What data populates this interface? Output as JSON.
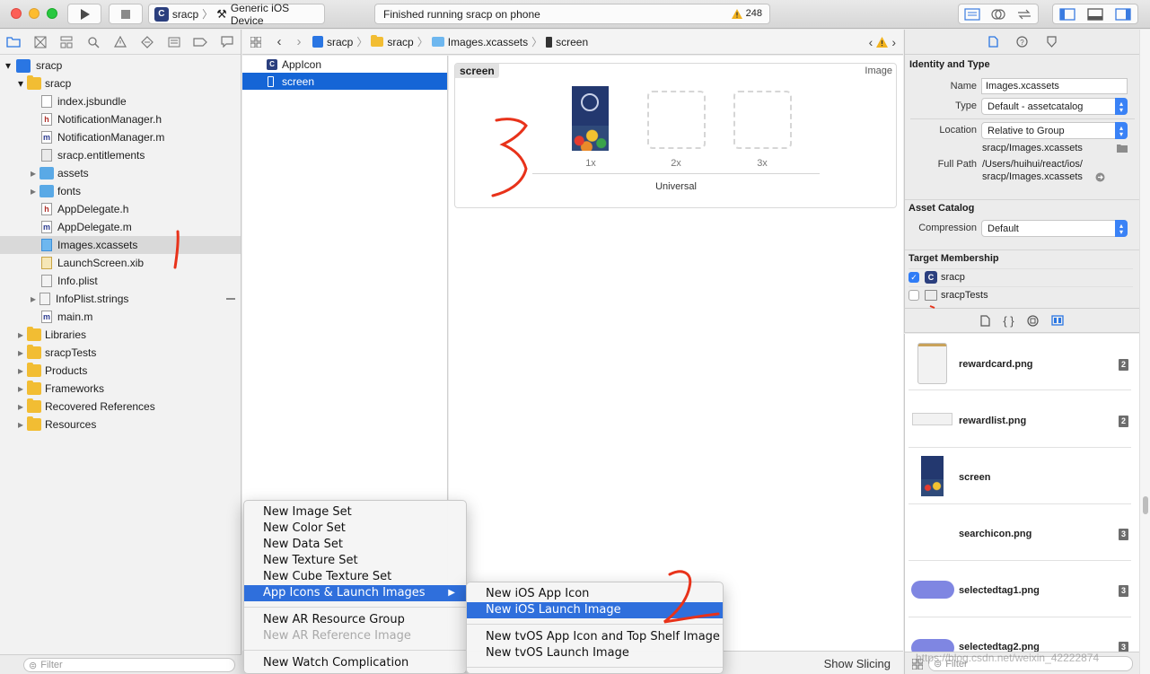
{
  "toolbar": {
    "scheme_name": "sracp",
    "device_name": "Generic iOS Device",
    "activity_text": "Finished running sracp on phone",
    "warning_count": "248"
  },
  "navigator": {
    "items": [
      {
        "label": "sracp",
        "icon": "xcode-project-icon"
      },
      {
        "label": "sracp",
        "icon": "folder-icon"
      },
      {
        "label": "index.jsbundle",
        "icon": "file-icon"
      },
      {
        "label": "NotificationManager.h",
        "icon": "header-file-icon",
        "letter": "h"
      },
      {
        "label": "NotificationManager.m",
        "icon": "objc-file-icon",
        "letter": "m"
      },
      {
        "label": "sracp.entitlements",
        "icon": "entitlements-file-icon"
      },
      {
        "label": "assets",
        "icon": "blue-folder-icon"
      },
      {
        "label": "fonts",
        "icon": "blue-folder-icon"
      },
      {
        "label": "AppDelegate.h",
        "icon": "header-file-icon",
        "letter": "h"
      },
      {
        "label": "AppDelegate.m",
        "icon": "objc-file-icon",
        "letter": "m"
      },
      {
        "label": "Images.xcassets",
        "icon": "asset-catalog-icon"
      },
      {
        "label": "LaunchScreen.xib",
        "icon": "xib-file-icon"
      },
      {
        "label": "Info.plist",
        "icon": "plist-file-icon"
      },
      {
        "label": "InfoPlist.strings",
        "icon": "strings-file-icon"
      },
      {
        "label": "main.m",
        "icon": "objc-file-icon",
        "letter": "m"
      },
      {
        "label": "Libraries",
        "icon": "folder-icon"
      },
      {
        "label": "sracpTests",
        "icon": "folder-icon"
      },
      {
        "label": "Products",
        "icon": "folder-icon"
      },
      {
        "label": "Frameworks",
        "icon": "folder-icon"
      },
      {
        "label": "Recovered References",
        "icon": "folder-icon"
      },
      {
        "label": "Resources",
        "icon": "folder-icon"
      }
    ],
    "filter_placeholder": "Filter"
  },
  "jumpbar": {
    "crumbs": [
      "sracp",
      "sracp",
      "Images.xcassets",
      "screen"
    ]
  },
  "asset_list": {
    "items": [
      "AppIcon",
      "screen"
    ]
  },
  "editor": {
    "set_name": "screen",
    "set_type": "Image",
    "slots": [
      "1x",
      "2x",
      "3x"
    ],
    "group_label": "Universal",
    "show_slicing": "Show Slicing"
  },
  "inspector": {
    "identity_title": "Identity and Type",
    "name_label": "Name",
    "name_value": "Images.xcassets",
    "type_label": "Type",
    "type_value": "Default - assetcatalog",
    "location_label": "Location",
    "location_value": "Relative to Group",
    "location_path": "sracp/Images.xcassets",
    "fullpath_label": "Full Path",
    "fullpath_line1": "/Users/huihui/react/ios/",
    "fullpath_line2": "sracp/Images.xcassets",
    "catalog_title": "Asset Catalog",
    "compression_label": "Compression",
    "compression_value": "Default",
    "membership_title": "Target Membership",
    "targets": [
      {
        "name": "sracp",
        "checked": true
      },
      {
        "name": "sracpTests",
        "checked": false
      }
    ]
  },
  "library": {
    "items": [
      {
        "name": "rewardcard.png",
        "badge": "2"
      },
      {
        "name": "rewardlist.png",
        "badge": "2"
      },
      {
        "name": "screen",
        "badge": ""
      },
      {
        "name": "searchicon.png",
        "badge": "3"
      },
      {
        "name": "selectedtag1.png",
        "badge": "3"
      },
      {
        "name": "selectedtag2.png",
        "badge": "3"
      }
    ],
    "filter_placeholder": "Filter"
  },
  "context_menu": {
    "items": [
      "New Image Set",
      "New Color Set",
      "New Data Set",
      "New Texture Set",
      "New Cube Texture Set",
      "App Icons & Launch Images"
    ],
    "items_b": [
      "New AR Resource Group",
      "New AR Reference Image"
    ],
    "items_c": [
      "New Watch Complication"
    ]
  },
  "submenu": {
    "items_a": [
      "New iOS App Icon",
      "New iOS Launch Image"
    ],
    "items_b": [
      "New tvOS App Icon and Top Shelf Image",
      "New tvOS Launch Image"
    ]
  },
  "annotations": [
    "1",
    "2",
    "3"
  ],
  "watermark": "https://blog.csdn.net/weixin_42222874",
  "colors": {
    "selection": "#1565d6",
    "menu_highlight": "#2f6fdc",
    "annotation": "#e8321a",
    "folder": "#f2bd33",
    "tag": "#7f86e2"
  }
}
